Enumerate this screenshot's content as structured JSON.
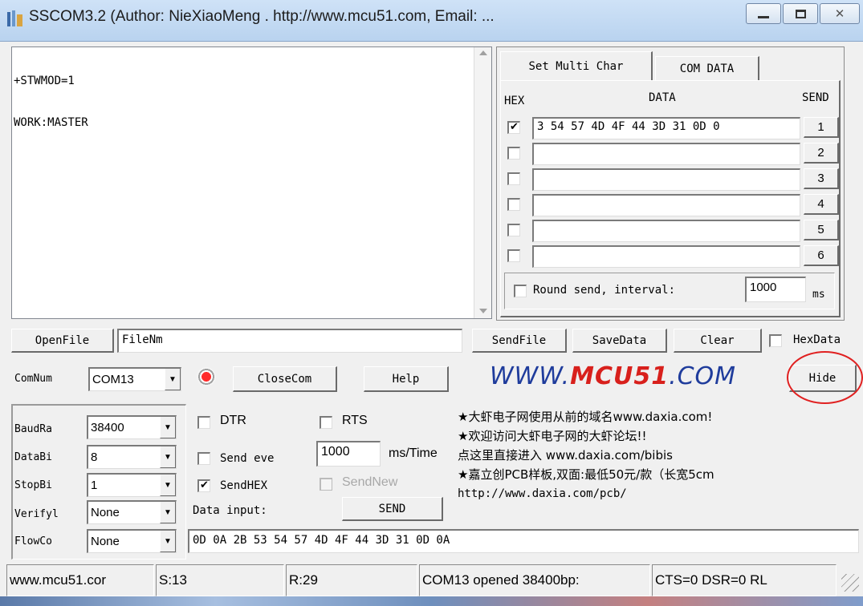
{
  "window": {
    "title": "SSCOM3.2 (Author: NieXiaoMeng . http://www.mcu51.com, Email: ..."
  },
  "receive": {
    "lines": [
      "+STWMOD=1",
      "WORK:MASTER"
    ]
  },
  "multi": {
    "tabs": [
      "Set Multi Char",
      "COM DATA"
    ],
    "headers": {
      "hex": "HEX",
      "data": "DATA",
      "send": "SEND"
    },
    "rows": [
      {
        "checked": true,
        "data": "3 54 57 4D 4F 44 3D 31 0D 0",
        "send": "1"
      },
      {
        "checked": false,
        "data": "",
        "send": "2"
      },
      {
        "checked": false,
        "data": "",
        "send": "3"
      },
      {
        "checked": false,
        "data": "",
        "send": "4"
      },
      {
        "checked": false,
        "data": "",
        "send": "5"
      },
      {
        "checked": false,
        "data": "",
        "send": "6"
      }
    ],
    "round_send_label": "Round send, interval:",
    "interval": "1000",
    "ms": "ms"
  },
  "toolbar": {
    "open_file": "OpenFile",
    "file_name": "FileNm",
    "send_file": "SendFile",
    "save_data": "SaveData",
    "clear": "Clear",
    "hex_data": "HexData"
  },
  "com_row": {
    "com_num_label": "ComNum",
    "com_num_value": "COM13",
    "close_com": "CloseCom",
    "help": "Help",
    "brand": "WWW.MCU51.COM",
    "hide": "Hide"
  },
  "settings": {
    "baud_label": "BaudRa",
    "baud_value": "38400",
    "databits_label": "DataBi",
    "databits_value": "8",
    "stopbits_label": "StopBi",
    "stopbits_value": "1",
    "verify_label": "Verifyl",
    "verify_value": "None",
    "flow_label": "FlowCo",
    "flow_value": "None"
  },
  "send_opts": {
    "dtr": "DTR",
    "rts": "RTS",
    "send_every": "Send eve",
    "every_value": "1000",
    "ms_time": "ms/Time",
    "send_hex": "SendHEX",
    "send_new": "SendNew",
    "data_input_label": "Data input:",
    "send_button": "SEND",
    "data_input_value": "0D 0A 2B 53 54 57 4D 4F 44 3D 31 0D 0A"
  },
  "ad": {
    "lines": [
      "★大虾电子网使用从前的域名www.daxia.com!",
      "★欢迎访问大虾电子网的大虾论坛!!",
      "点这里直接进入 www.daxia.com/bibis",
      "★嘉立创PCB样板,双面:最低50元/款（长宽5cm",
      "http://www.daxia.com/pcb/"
    ]
  },
  "status": {
    "site": "www.mcu51.cor",
    "sent": "S:13",
    "received": "R:29",
    "port_state": "COM13 opened 38400bp:",
    "lines": "CTS=0 DSR=0 RL"
  },
  "colors": {
    "brand_blue": "#1f3c9c",
    "brand_red": "#d8201c",
    "annotation_red": "#e02020"
  }
}
